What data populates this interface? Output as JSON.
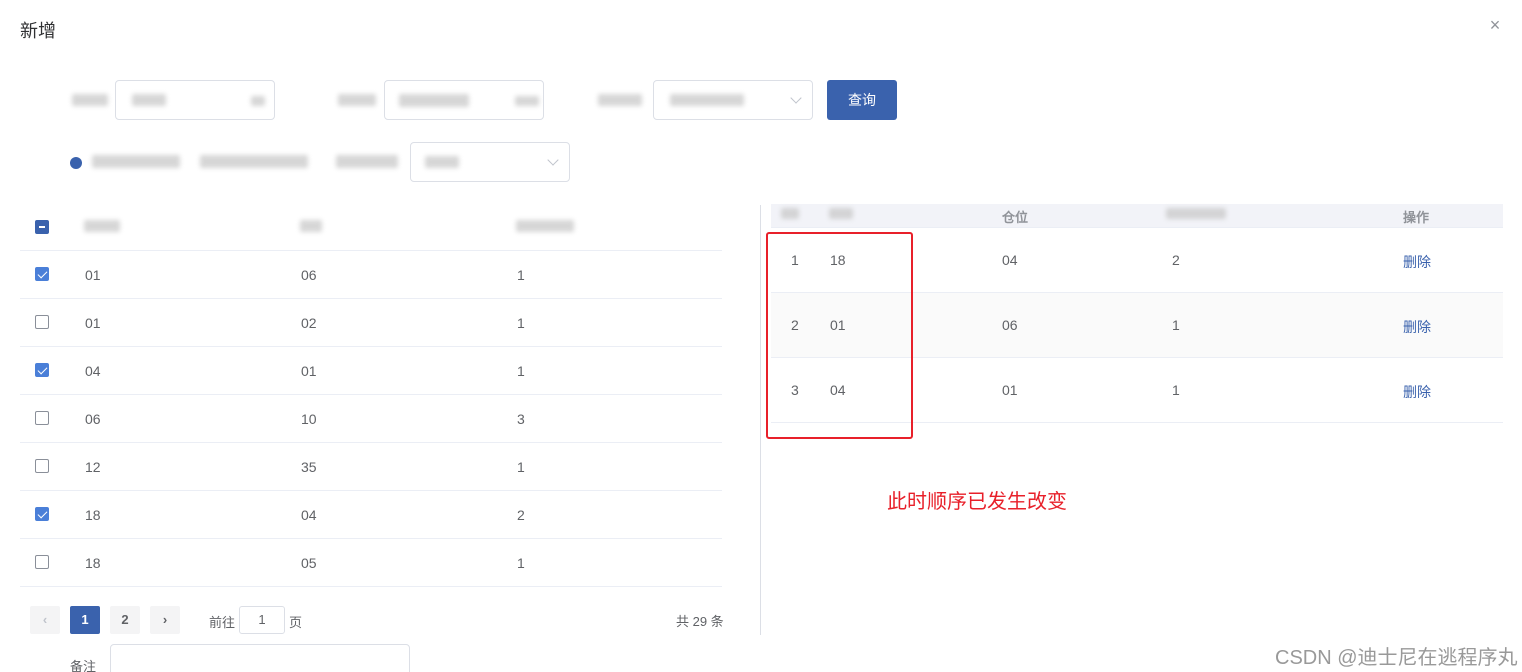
{
  "dialog": {
    "title": "新增",
    "close_icon": "×"
  },
  "filters": {
    "query_button": "查询"
  },
  "left_table": {
    "rows": [
      {
        "checked": true,
        "c1": "01",
        "c2": "06",
        "c3": "1"
      },
      {
        "checked": false,
        "c1": "01",
        "c2": "02",
        "c3": "1"
      },
      {
        "checked": true,
        "c1": "04",
        "c2": "01",
        "c3": "1"
      },
      {
        "checked": false,
        "c1": "06",
        "c2": "10",
        "c3": "3"
      },
      {
        "checked": false,
        "c1": "12",
        "c2": "35",
        "c3": "1"
      },
      {
        "checked": true,
        "c1": "18",
        "c2": "04",
        "c3": "2"
      },
      {
        "checked": false,
        "c1": "18",
        "c2": "05",
        "c3": "1"
      }
    ]
  },
  "pagination": {
    "prev": "‹",
    "page1": "1",
    "page2": "2",
    "next": "›",
    "goto_label": "前往",
    "goto_value": "1",
    "page_unit": "页",
    "total": "共 29 条"
  },
  "right_table": {
    "headers": {
      "c3": "仓位",
      "op": "操作"
    },
    "rows": [
      {
        "idx": "1",
        "c1": "18",
        "c2": "04",
        "c3": "2",
        "op": "删除"
      },
      {
        "idx": "2",
        "c1": "01",
        "c2": "06",
        "c3": "1",
        "op": "删除"
      },
      {
        "idx": "3",
        "c1": "04",
        "c2": "01",
        "c3": "1",
        "op": "删除"
      }
    ]
  },
  "remark": {
    "label": "备注",
    "value": ""
  },
  "annotation": {
    "text": "此时顺序已发生改变",
    "color": "#e8202a"
  },
  "watermark": "CSDN @迪士尼在逃程序丸",
  "colors": {
    "primary": "#3a62ad",
    "checked": "#4a7fd8",
    "annotation": "#e8202a"
  }
}
